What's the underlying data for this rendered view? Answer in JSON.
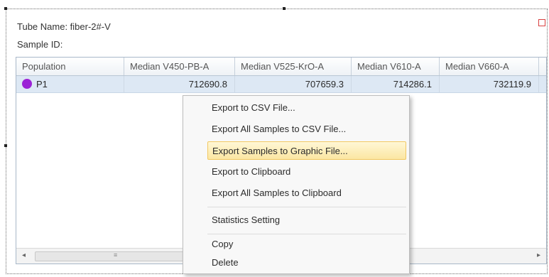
{
  "panel": {
    "tube_name": "Tube Name: fiber-2#-V",
    "sample_id": "Sample ID:"
  },
  "table": {
    "headers": [
      "Population",
      "Median V450-PB-A",
      "Median V525-KrO-A",
      "Median V610-A",
      "Median V660-A"
    ],
    "rows": [
      {
        "population": "P1",
        "color": "#9b22d6",
        "values": [
          "712690.8",
          "707659.3",
          "714286.1",
          "732119.9"
        ]
      }
    ]
  },
  "scrollbar": {
    "left_arrow": "◂",
    "right_arrow": "▸",
    "grip": "≡"
  },
  "context_menu": {
    "items": [
      "Export to CSV File...",
      "Export All Samples to CSV File...",
      "Export Samples to Graphic File...",
      "Export to Clipboard",
      "Export All Samples to Clipboard",
      "Statistics Setting",
      "Copy",
      "Delete"
    ],
    "highlighted_index": 2
  },
  "colors": {
    "selection": "#dde8f4",
    "menu_highlight": "#fbe6a2",
    "population_dot": "#9b22d6"
  }
}
